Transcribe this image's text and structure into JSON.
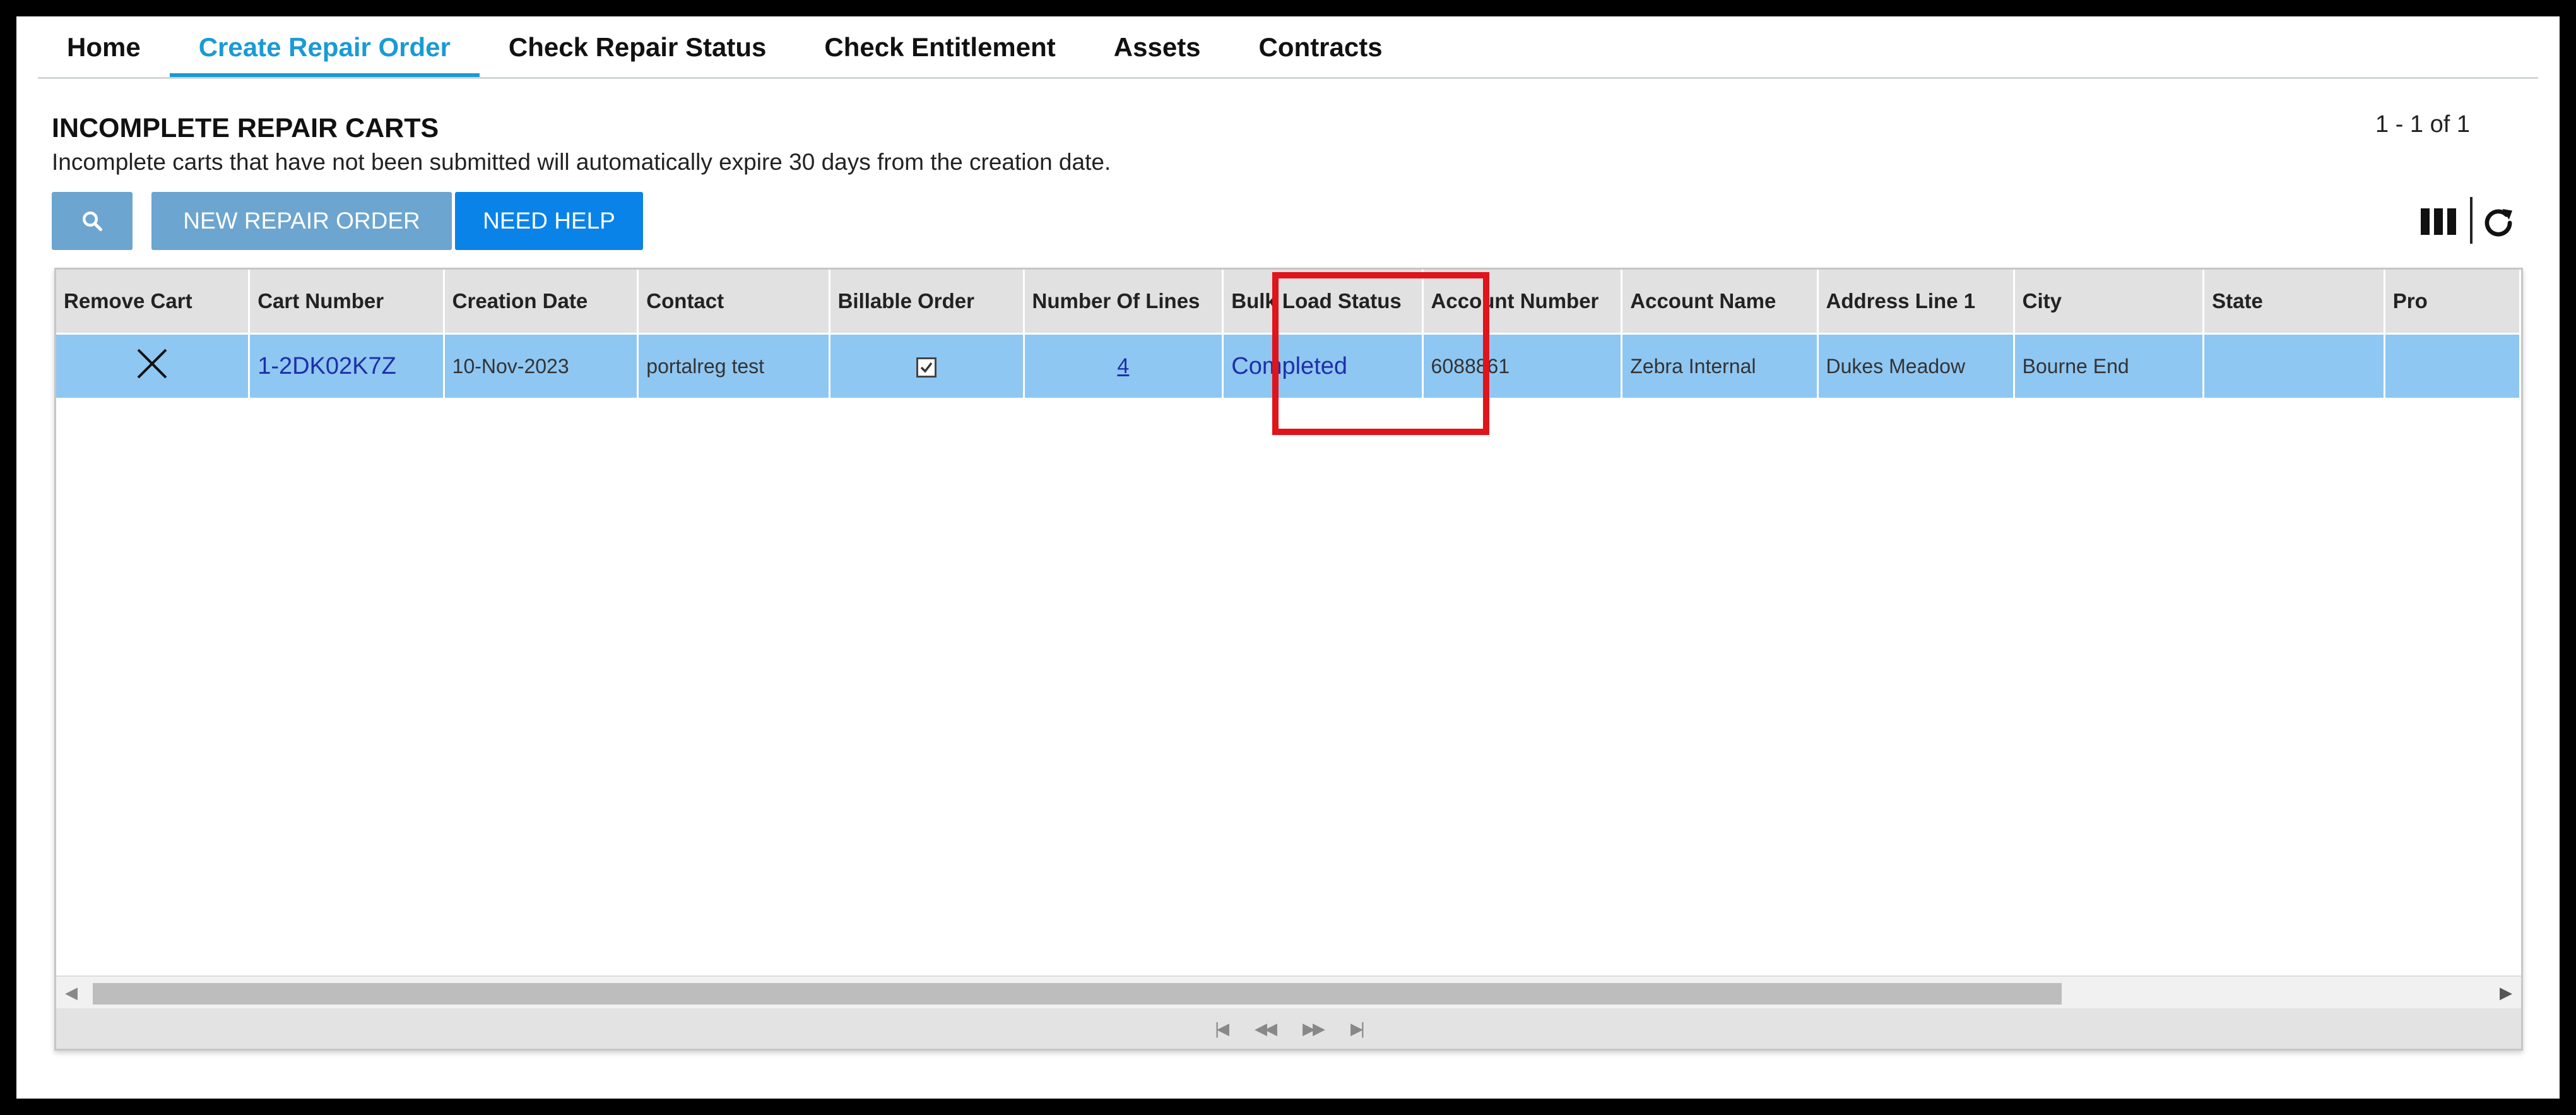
{
  "nav": {
    "tabs": [
      {
        "label": "Home"
      },
      {
        "label": "Create Repair Order"
      },
      {
        "label": "Check Repair Status"
      },
      {
        "label": "Check Entitlement"
      },
      {
        "label": "Assets"
      },
      {
        "label": "Contracts"
      }
    ],
    "active_tab": "Create Repair Order"
  },
  "page": {
    "title": "INCOMPLETE REPAIR CARTS",
    "subtitle": "Incomplete carts that have not been submitted will automatically expire 30 days from the creation date.",
    "paging": "1 - 1 of 1"
  },
  "toolbar": {
    "search_icon": "search-icon",
    "new_label": "NEW REPAIR ORDER",
    "help_label": "NEED HELP"
  },
  "grid": {
    "columns": [
      "Remove Cart",
      "Cart Number",
      "Creation Date",
      "Contact",
      "Billable Order",
      "Number Of Lines",
      "Bulk Load Status",
      "Account Number",
      "Account Name",
      "Address Line 1",
      "City",
      "State",
      "Pro"
    ],
    "rows": [
      {
        "remove": "×",
        "cart_number": "1-2DK02K7Z",
        "creation_date": "10-Nov-2023",
        "contact": "portalreg test",
        "billable": true,
        "lines": "4",
        "bulk_status": "Completed",
        "account_number": "6088861",
        "account_name": "Zebra Internal",
        "address1": "Dukes Meadow",
        "city": "Bourne End",
        "state": "",
        "pro": ""
      }
    ]
  },
  "colors": {
    "active_tab": "#1a9ad6",
    "selected_row": "#8fc7f3",
    "button_light": "#6ca5cf",
    "button_primary": "#0a83e8",
    "highlight": "#e0141a"
  }
}
